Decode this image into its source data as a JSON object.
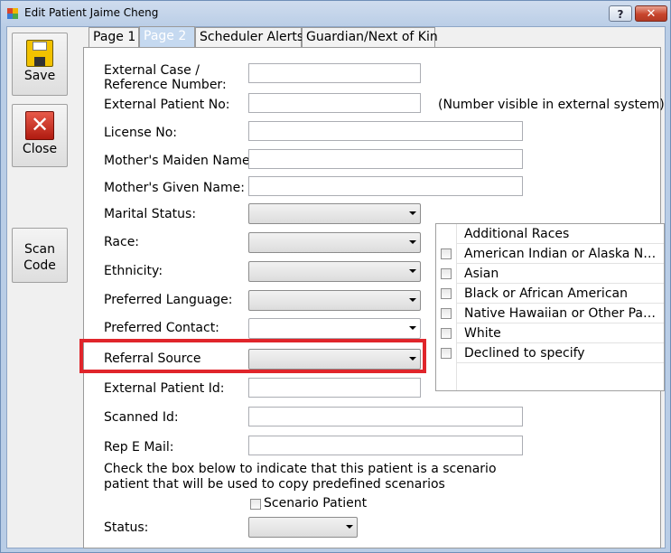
{
  "window": {
    "title": "Edit Patient Jaime Cheng",
    "help_label": "?",
    "close_label": "✕"
  },
  "sidebar": {
    "save_label": "Save",
    "close_label": "Close",
    "scan_label_line1": "Scan",
    "scan_label_line2": "Code"
  },
  "tabs": [
    {
      "label": "Page 1",
      "active": false
    },
    {
      "label": "Page 2",
      "active": true
    },
    {
      "label": "Scheduler Alerts",
      "active": false
    },
    {
      "label": "Guardian/Next of Kin",
      "active": false
    }
  ],
  "form": {
    "external_case_label_1": "External Case /",
    "external_case_label_2": "Reference Number:",
    "external_case_value": "",
    "external_patient_no_label": "External Patient No:",
    "external_patient_no_value": "",
    "external_patient_no_hint": "(Number visible in external system)",
    "license_no_label": "License No:",
    "license_no_value": "",
    "mothers_maiden_label": "Mother's Maiden Name:",
    "mothers_maiden_value": "",
    "mothers_given_label": "Mother's Given Name:",
    "mothers_given_value": "",
    "marital_status_label": "Marital Status:",
    "marital_status_value": "",
    "race_label": "Race:",
    "race_value": "",
    "ethnicity_label": "Ethnicity:",
    "ethnicity_value": "",
    "preferred_language_label": "Preferred Language:",
    "preferred_language_value": "",
    "preferred_contact_label": "Preferred Contact:",
    "preferred_contact_value": "",
    "referral_source_label": "Referral Source",
    "referral_source_value": "",
    "external_patient_id_label": "External Patient Id:",
    "external_patient_id_value": "",
    "scanned_id_label": "Scanned Id:",
    "scanned_id_value": "",
    "rep_email_label": "Rep E Mail:",
    "rep_email_value": "",
    "scenario_note_1": "Check the box below to indicate that this patient is a scenario",
    "scenario_note_2": "patient that will be used to copy  predefined scenarios",
    "scenario_patient_label": "Scenario Patient",
    "scenario_patient_checked": false,
    "status_label": "Status:",
    "status_value": ""
  },
  "additional_races": {
    "header": "Additional Races",
    "items": [
      {
        "label": "American Indian or Alaska Na...",
        "checked": false
      },
      {
        "label": "Asian",
        "checked": false
      },
      {
        "label": "Black or African American",
        "checked": false
      },
      {
        "label": "Native Hawaiian or Other Pac...",
        "checked": false
      },
      {
        "label": "White",
        "checked": false
      },
      {
        "label": "Declined to specify",
        "checked": false
      }
    ]
  },
  "colors": {
    "highlight": "#e0252b",
    "active_tab": "#c5d9f0"
  }
}
